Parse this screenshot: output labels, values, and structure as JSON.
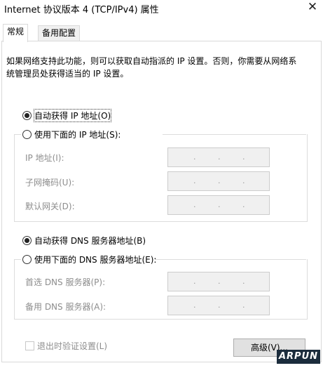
{
  "window": {
    "title": "Internet 协议版本 4 (TCP/IPv4) 属性",
    "close_glyph": "✕"
  },
  "tabs": [
    {
      "label": "常规",
      "active": true
    },
    {
      "label": "备用配置",
      "active": false
    }
  ],
  "description": "如果网络支持此功能，则可以获取自动指派的 IP 设置。否则，你需要从网络系统管理员处获得适当的 IP 设置。",
  "ip_section": {
    "auto_label": "自动获得 IP 地址(O)",
    "manual_label": "使用下面的 IP 地址(S):",
    "selected": "auto",
    "fields": [
      {
        "label": "IP 地址(I):",
        "value": ". . ."
      },
      {
        "label": "子网掩码(U):",
        "value": ". . ."
      },
      {
        "label": "默认网关(D):",
        "value": ". . ."
      }
    ]
  },
  "dns_section": {
    "auto_label": "自动获得 DNS 服务器地址(B)",
    "manual_label": "使用下面的 DNS 服务器地址(E):",
    "selected": "auto",
    "fields": [
      {
        "label": "首选 DNS 服务器(P):",
        "value": ". . ."
      },
      {
        "label": "备用 DNS 服务器(A):",
        "value": ". . ."
      }
    ]
  },
  "validate_checkbox": {
    "label": "退出时验证设置(L)",
    "checked": false,
    "enabled": false
  },
  "advanced_button": {
    "label": "高级(V)..."
  },
  "watermark": "ARPUN"
}
